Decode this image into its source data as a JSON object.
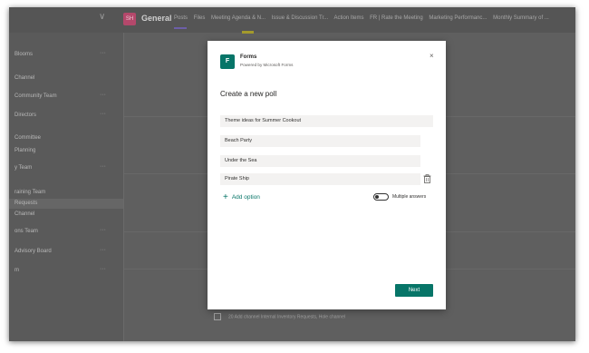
{
  "header": {
    "team_tile_text": "SH",
    "channel_name": "General",
    "tabs": [
      "Posts",
      "Files",
      "Meeting Agenda & N...",
      "Issue & Discussion Tr...",
      "Action Items",
      "FR | Rate the Meeting",
      "Marketing Performanc...",
      "Monthly Summary of ..."
    ]
  },
  "sidebar": {
    "items": [
      {
        "label": "Blooms",
        "dots": "···"
      },
      {
        "label": "Channel",
        "dots": ""
      },
      {
        "label": "Community Team",
        "dots": "···"
      },
      {
        "label": "Directors",
        "dots": "···"
      },
      {
        "label": "Committee",
        "dots": ""
      },
      {
        "label": "Planning",
        "dots": ""
      },
      {
        "label": "y Team",
        "dots": "···"
      },
      {
        "label": "raining Team",
        "dots": ""
      },
      {
        "label": "Requests",
        "dots": ""
      },
      {
        "label": "Channel",
        "dots": ""
      },
      {
        "label": "ons Team",
        "dots": "···"
      },
      {
        "label": "Advisory Board",
        "dots": "···"
      },
      {
        "label": "m",
        "dots": "···"
      }
    ]
  },
  "bottom_row": {
    "text": "20 Add channel Internal Inventory Requests, Hole channel"
  },
  "modal": {
    "app_title": "Forms",
    "app_subtitle": "Powered by Microsoft Forms",
    "app_icon_text": "F",
    "heading": "Create a new poll",
    "question": "Theme ideas for Summer Cookout",
    "options": [
      "Beach Party",
      "Under the Sea",
      "Pirate Ship"
    ],
    "add_option_label": "Add option",
    "multiple_answers_label": "Multiple answers",
    "next_label": "Next",
    "close_glyph": "×"
  },
  "colors": {
    "accent": "#077568",
    "overlay": "#5f5f5f"
  }
}
